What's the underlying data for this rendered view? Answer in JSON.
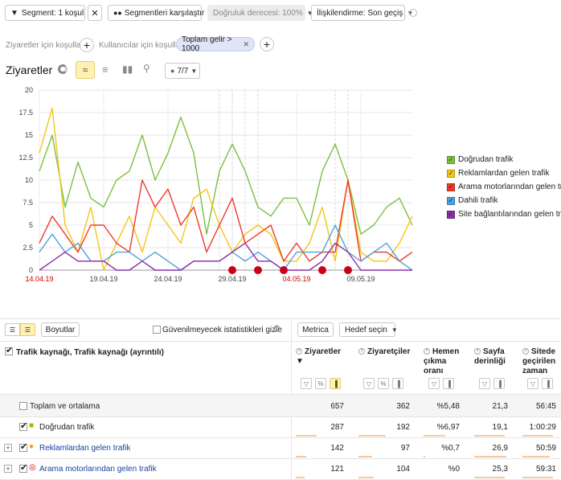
{
  "toolbar": {
    "segment_label": "Segment: 1 koşul",
    "compare_label": "Segmentleri karşılaştır",
    "accuracy_label": "Doğruluk derecesi: 100%",
    "attribution_label": "İlişkilendirme: Son geçiş"
  },
  "conditions": {
    "visits_label": "Ziyaretler için koşullar:",
    "users_label": "Kullanıcılar için koşullar:",
    "filter_tag": "Toplam gelir > 1000"
  },
  "chart_header": {
    "title": "Ziyaretler",
    "series_selector": "7/7"
  },
  "chart_data": {
    "type": "line",
    "x": [
      "14.04.19",
      "15.04.19",
      "16.04.19",
      "17.04.19",
      "18.04.19",
      "19.04.19",
      "20.04.19",
      "21.04.19",
      "22.04.19",
      "23.04.19",
      "24.04.19",
      "25.04.19",
      "26.04.19",
      "27.04.19",
      "28.04.19",
      "29.04.19",
      "30.04.19",
      "01.05.19",
      "02.05.19",
      "03.05.19",
      "04.05.19",
      "05.05.19",
      "06.05.19",
      "07.05.19",
      "08.05.19",
      "09.05.19",
      "10.05.19",
      "11.05.19",
      "12.05.19",
      "13.05.19"
    ],
    "xtick_labels": [
      "14.04.19",
      "19.04.19",
      "24.04.19",
      "29.04.19",
      "04.05.19",
      "09.05.19"
    ],
    "holiday_ticks": [
      "14.04.19",
      "04.05.19"
    ],
    "yticks": [
      "0",
      "2.5",
      "5",
      "7.5",
      "10",
      "12.5",
      "15",
      "17.5",
      "20"
    ],
    "ylim": [
      0,
      20
    ],
    "grid": true,
    "legend": "right",
    "series": [
      {
        "name": "Doğrudan trafik",
        "color": "#7bc043",
        "values": [
          11,
          15,
          7,
          12,
          8,
          7,
          10,
          11,
          15,
          10,
          13,
          17,
          13,
          4,
          11,
          14,
          11,
          7,
          6,
          8,
          8,
          5,
          11,
          14,
          10,
          4,
          5,
          7,
          8,
          5
        ]
      },
      {
        "name": "Reklamlardan gelen trafik",
        "color": "#f5c518",
        "values": [
          13,
          18,
          5,
          2,
          7,
          0,
          3,
          6,
          2,
          7,
          5,
          3,
          8,
          9,
          5,
          2,
          4,
          5,
          4,
          1,
          1,
          3,
          7,
          1,
          10,
          2,
          1,
          1,
          3,
          6
        ]
      },
      {
        "name": "Arama motorlarından gelen trafik",
        "color": "#ee3a2c",
        "values": [
          3,
          6,
          4,
          2,
          5,
          5,
          3,
          2,
          10,
          7,
          9,
          5,
          7,
          2,
          5,
          8,
          3,
          4,
          5,
          1,
          3,
          1,
          2,
          2,
          10,
          1,
          2,
          2,
          1,
          2
        ]
      },
      {
        "name": "Dahili trafik",
        "color": "#4ca2e0",
        "values": [
          2,
          4,
          2,
          3,
          1,
          1,
          2,
          2,
          1,
          2,
          1,
          0,
          1,
          1,
          1,
          2,
          1,
          2,
          1,
          0,
          2,
          2,
          2,
          5,
          2,
          1,
          2,
          3,
          1,
          0
        ]
      },
      {
        "name": "Site bağlantılarından gelen trafik",
        "color": "#8b2fa5",
        "values": [
          0,
          1,
          2,
          1,
          1,
          1,
          0,
          0,
          1,
          0,
          0,
          0,
          1,
          1,
          1,
          2,
          3,
          1,
          1,
          0,
          0,
          0,
          1,
          3,
          2,
          0,
          0,
          0,
          0,
          0
        ]
      }
    ]
  },
  "table_toolbar": {
    "dimensions_label": "Boyutlar",
    "hide_unreliable_label": "Güvenilmeyecek istatistikleri gizle",
    "metrics_label": "Metrica",
    "goal_label": "Hedef seçin"
  },
  "table": {
    "dimension_header": "Trafik kaynağı, Trafik kaynağı (ayrıntılı)",
    "columns": [
      {
        "label": "Ziyaretler",
        "sort": "▼"
      },
      {
        "label": "Ziyaretçiler",
        "sort": ""
      },
      {
        "label": "Hemen çıkma oranı",
        "sort": ""
      },
      {
        "label": "Sayfa derinliği",
        "sort": ""
      },
      {
        "label": "Sitede geçirilen zaman",
        "sort": ""
      }
    ],
    "total_label": "Toplam ve ortalama",
    "total_values": [
      "657",
      "362",
      "%5,48",
      "21,3",
      "56:45"
    ],
    "rows": [
      {
        "label": "Doğrudan trafik",
        "values": [
          "287",
          "192",
          "%6,97",
          "19,1",
          "1:00:29"
        ],
        "bars": [
          0.44,
          0.53,
          0.6,
          0.9,
          0.9
        ]
      },
      {
        "label": "Reklamlardan gelen trafik",
        "values": [
          "142",
          "97",
          "%0,7",
          "26,9",
          "50:59"
        ],
        "bars": [
          0.22,
          0.27,
          0.05,
          0.95,
          0.8
        ]
      },
      {
        "label": "Arama motorlarından gelen trafik",
        "values": [
          "121",
          "104",
          "%0",
          "25,3",
          "59:31"
        ],
        "bars": [
          0.18,
          0.29,
          0.0,
          0.9,
          0.9
        ]
      }
    ]
  }
}
